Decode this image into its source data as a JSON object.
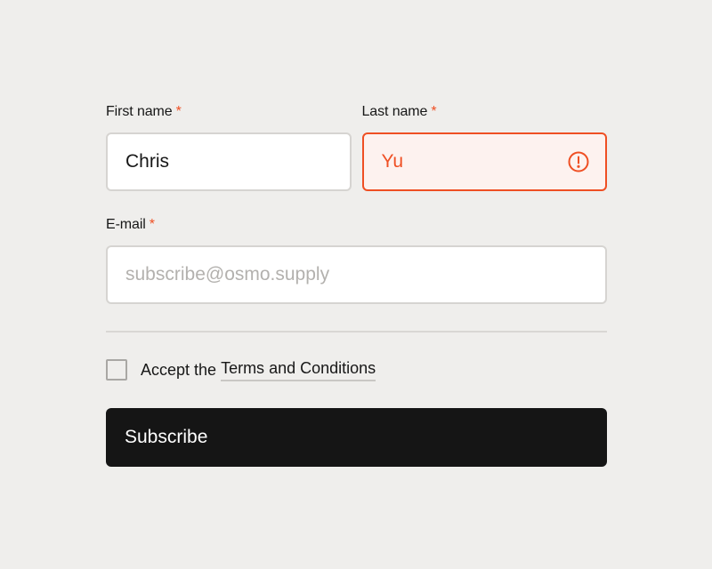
{
  "form": {
    "first_name": {
      "label": "First name",
      "required_mark": "*",
      "value": "Chris"
    },
    "last_name": {
      "label": "Last name",
      "required_mark": "*",
      "value": "Yu",
      "state": "error",
      "icon": "alert-circle-icon"
    },
    "email": {
      "label": "E-mail",
      "required_mark": "*",
      "value": "",
      "placeholder": "subscribe@osmo.supply"
    },
    "terms": {
      "checked": false,
      "text": "Accept the",
      "link_text": "Terms and Conditions"
    },
    "submit_label": "Subscribe"
  },
  "colors": {
    "background": "#efeeec",
    "error": "#ef4f23",
    "error_bg": "#fdf2ef",
    "button": "#151515",
    "border": "#d6d4d1"
  }
}
